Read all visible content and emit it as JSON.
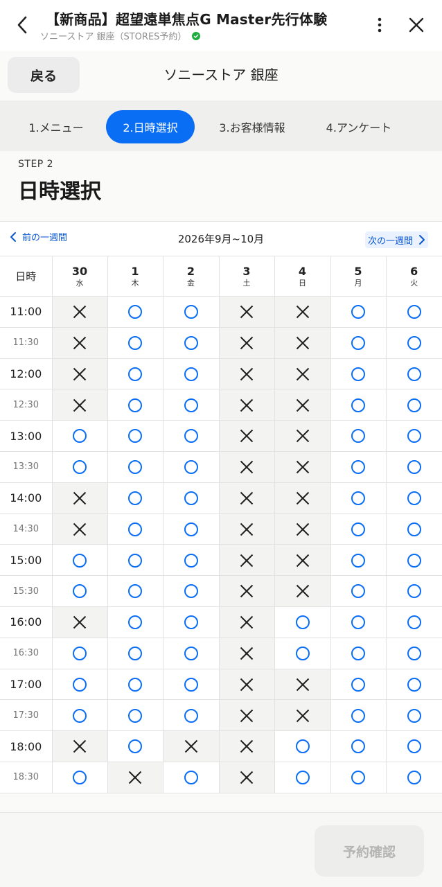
{
  "appbar": {
    "title": "【新商品】超望遠単焦点G Master先行体験",
    "subtitle": "ソニーストア 銀座（STORES予約）"
  },
  "store": {
    "back_label": "戻る",
    "name": "ソニーストア 銀座"
  },
  "steps": [
    {
      "label": "1.メニュー",
      "active": false
    },
    {
      "label": "2.日時選択",
      "active": true
    },
    {
      "label": "3.お客様情報",
      "active": false
    },
    {
      "label": "4.アンケート",
      "active": false
    }
  ],
  "step_heading": {
    "step_no": "STEP 2",
    "title": "日時選択"
  },
  "week_nav": {
    "prev_label": "前の一週間",
    "range_label": "2026年9月~10月",
    "next_label": "次の一週間"
  },
  "calendar": {
    "corner_label": "日時",
    "days": [
      {
        "date": "30",
        "weekday": "水"
      },
      {
        "date": "1",
        "weekday": "木"
      },
      {
        "date": "2",
        "weekday": "金"
      },
      {
        "date": "3",
        "weekday": "土"
      },
      {
        "date": "4",
        "weekday": "日"
      },
      {
        "date": "5",
        "weekday": "月"
      },
      {
        "date": "6",
        "weekday": "火"
      }
    ],
    "slots": [
      {
        "time": "11:00",
        "avail": [
          "x",
          "o",
          "o",
          "x",
          "x",
          "o",
          "o"
        ]
      },
      {
        "time": "11:30",
        "avail": [
          "x",
          "o",
          "o",
          "x",
          "x",
          "o",
          "o"
        ]
      },
      {
        "time": "12:00",
        "avail": [
          "x",
          "o",
          "o",
          "x",
          "x",
          "o",
          "o"
        ]
      },
      {
        "time": "12:30",
        "avail": [
          "x",
          "o",
          "o",
          "x",
          "x",
          "o",
          "o"
        ]
      },
      {
        "time": "13:00",
        "avail": [
          "o",
          "o",
          "o",
          "x",
          "x",
          "o",
          "o"
        ]
      },
      {
        "time": "13:30",
        "avail": [
          "o",
          "o",
          "o",
          "x",
          "x",
          "o",
          "o"
        ]
      },
      {
        "time": "14:00",
        "avail": [
          "x",
          "o",
          "o",
          "x",
          "x",
          "o",
          "o"
        ]
      },
      {
        "time": "14:30",
        "avail": [
          "x",
          "o",
          "o",
          "x",
          "x",
          "o",
          "o"
        ]
      },
      {
        "time": "15:00",
        "avail": [
          "o",
          "o",
          "o",
          "x",
          "x",
          "o",
          "o"
        ]
      },
      {
        "time": "15:30",
        "avail": [
          "o",
          "o",
          "o",
          "x",
          "x",
          "o",
          "o"
        ]
      },
      {
        "time": "16:00",
        "avail": [
          "x",
          "o",
          "o",
          "x",
          "o",
          "o",
          "o"
        ]
      },
      {
        "time": "16:30",
        "avail": [
          "o",
          "o",
          "o",
          "x",
          "o",
          "o",
          "o"
        ]
      },
      {
        "time": "17:00",
        "avail": [
          "o",
          "o",
          "o",
          "x",
          "x",
          "o",
          "o"
        ]
      },
      {
        "time": "17:30",
        "avail": [
          "o",
          "o",
          "o",
          "x",
          "x",
          "o",
          "o"
        ]
      },
      {
        "time": "18:00",
        "avail": [
          "x",
          "o",
          "x",
          "x",
          "o",
          "o",
          "o"
        ]
      },
      {
        "time": "18:30",
        "avail": [
          "o",
          "x",
          "o",
          "x",
          "o",
          "o",
          "o"
        ]
      }
    ]
  },
  "footer": {
    "reserve_label": "予約確認"
  },
  "colors": {
    "accent": "#0a6ef5",
    "link": "#0a57d0",
    "unavailable_bg": "#f3f3f2"
  }
}
